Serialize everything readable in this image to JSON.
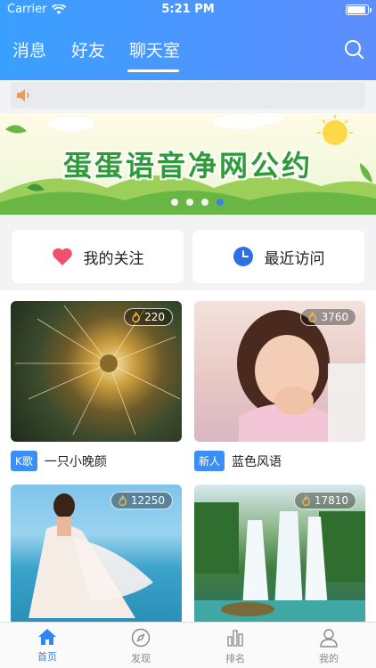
{
  "status": {
    "carrier": "Carrier",
    "time": "5:21 PM"
  },
  "nav": {
    "tabs": [
      "消息",
      "好友",
      "聊天室"
    ],
    "active_tab": 2
  },
  "notice": {
    "text": ""
  },
  "banner": {
    "title": "蛋蛋语音净网公约",
    "page_count": 4,
    "active_page": 3
  },
  "quick": {
    "follow_label": "我的关注",
    "recent_label": "最近访问"
  },
  "rooms": [
    {
      "tag": "K歌",
      "name": "一只小晚颜",
      "heat": "220"
    },
    {
      "tag": "新人",
      "name": "蓝色风语",
      "heat": "3760"
    },
    {
      "tag": "",
      "name": "",
      "heat": "12250"
    },
    {
      "tag": "",
      "name": "",
      "heat": "17810"
    }
  ],
  "tabbar": {
    "items": [
      "首页",
      "发现",
      "排名",
      "我的"
    ],
    "active": 0
  },
  "colors": {
    "accent": "#3a8ef5",
    "header_start": "#3aa0ff",
    "header_end": "#5d8dff",
    "heart": "#f0506e",
    "clock": "#2f6fe4"
  }
}
